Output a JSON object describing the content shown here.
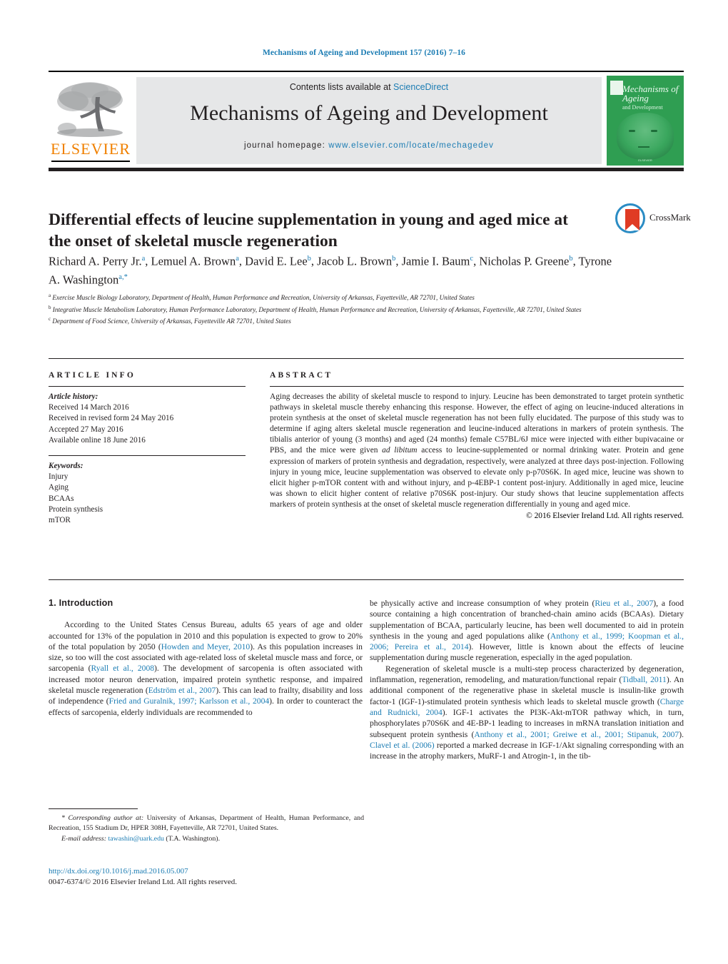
{
  "running_head": "Mechanisms of Ageing and Development 157 (2016) 7–16",
  "masthead": {
    "contents_prefix": "Contents lists available at ",
    "contents_link": "ScienceDirect",
    "journal_title": "Mechanisms of Ageing and Development",
    "homepage_label": "journal homepage: ",
    "homepage_url": "www.elsevier.com/locate/mechagedev",
    "publisher_wordmark": "ELSEVIER",
    "publisher_accent": "#f08000",
    "link_color": "#1b7cb3",
    "band_color": "#e6e7e8",
    "cover": {
      "title": "Mechanisms of Ageing",
      "subtitle": "and Development",
      "footer": "ELSEVIER",
      "background": "#2f9e52"
    }
  },
  "article": {
    "title": "Differential effects of leucine supplementation in young and aged mice at the onset of skeletal muscle regeneration",
    "crossmark_label": "CrossMark",
    "authors_html": "Richard A. Perry Jr.<sup>a</sup>, Lemuel A. Brown<sup>a</sup>, David E. Lee<sup>b</sup>, Jacob L. Brown<sup>b</sup>, Jamie I. Baum<sup>c</sup>, Nicholas P. Greene<sup>b</sup>, Tyrone A. Washington<sup>a,</sup><sup>*</sup>",
    "affiliations": [
      "Exercise Muscle Biology Laboratory, Department of Health, Human Performance and Recreation, University of Arkansas, Fayetteville, AR 72701, United States",
      "Integrative Muscle Metabolism Laboratory, Human Performance Laboratory, Department of Health, Human Performance and Recreation, University of Arkansas, Fayetteville, AR 72701, United States",
      "Department of Food Science, University of Arkansas, Fayetteville AR 72701, United States"
    ],
    "affiliation_marks": [
      "a",
      "b",
      "c"
    ]
  },
  "article_info": {
    "heading": "ARTICLE INFO",
    "history_label": "Article history:",
    "history": [
      "Received 14 March 2016",
      "Received in revised form 24 May 2016",
      "Accepted 27 May 2016",
      "Available online 18 June 2016"
    ],
    "keywords_label": "Keywords:",
    "keywords": [
      "Injury",
      "Aging",
      "BCAAs",
      "Protein synthesis",
      "mTOR"
    ]
  },
  "abstract": {
    "heading": "ABSTRACT",
    "text_html": "Aging decreases the ability of skeletal muscle to respond to injury. Leucine has been demonstrated to target protein synthetic pathways in skeletal muscle thereby enhancing this response. However, the effect of aging on leucine-induced alterations in protein synthesis at the onset of skeletal muscle regeneration has not been fully elucidated. The purpose of this study was to determine if aging alters skeletal muscle regeneration and leucine-induced alterations in markers of protein synthesis. The tibialis anterior of young (3 months) and aged (24 months) female C57BL/6J mice were injected with either bupivacaine or PBS, and the mice were given <i>ad libitum</i> access to leucine-supplemented or normal drinking water. Protein and gene expression of markers of protein synthesis and degradation, respectively, were analyzed at three days post-injection. Following injury in young mice, leucine supplementation was observed to elevate only p-p70S6K. In aged mice, leucine was shown to elicit higher p-mTOR content with and without injury, and p-4EBP-1 content post-injury. Additionally in aged mice, leucine was shown to elicit higher content of relative p70S6K post-injury. Our study shows that leucine supplementation affects markers of protein synthesis at the onset of skeletal muscle regeneration differentially in young and aged mice.",
    "copyright": "© 2016 Elsevier Ireland Ltd. All rights reserved."
  },
  "body": {
    "section_heading": "1. Introduction",
    "left_paragraphs_html": [
      "According to the United States Census Bureau, adults 65 years of age and older accounted for 13% of the population in 2010 and this population is expected to grow to 20% of the total population by 2050 (<span class=\"ref\">Howden and Meyer, 2010</span>). As this population increases in size, so too will the cost associated with age-related loss of skeletal muscle mass and force, or sarcopenia (<span class=\"ref\">Ryall et al., 2008</span>). The development of sarcopenia is often associated with increased motor neuron denervation, impaired protein synthetic response, and impaired skeletal muscle regeneration (<span class=\"ref\">Edström et al., 2007</span>). This can lead to frailty, disability and loss of independence (<span class=\"ref\">Fried and Guralnik, 1997; Karlsson et al., 2004</span>). In order to counteract the effects of sarcopenia, elderly individuals are recommended to"
    ],
    "right_paragraphs_html": [
      "be physically active and increase consumption of whey protein (<span class=\"ref\">Rieu et al., 2007</span>), a food source containing a high concentration of branched-chain amino acids (BCAAs). Dietary supplementation of BCAA, particularly leucine, has been well documented to aid in protein synthesis in the young and aged populations alike (<span class=\"ref\">Anthony et al., 1999; Koopman et al., 2006; Pereira et al., 2014</span>). However, little is known about the effects of leucine supplementation during muscle regeneration, especially in the aged population.",
      "Regeneration of skeletal muscle is a multi-step process characterized by degeneration, inflammation, regeneration, remodeling, and maturation/functional repair (<span class=\"ref\">Tidball, 2011</span>). An additional component of the regenerative phase in skeletal muscle is insulin-like growth factor-1 (IGF-1)-stimulated protein synthesis which leads to skeletal muscle growth (<span class=\"ref\">Charge and Rudnicki, 2004</span>). IGF-1 activates the PI3K-Akt-mTOR pathway which, in turn, phosphorylates p70S6K and 4E-BP-1 leading to increases in mRNA translation initiation and subsequent protein synthesis (<span class=\"ref\">Anthony et al., 2001; Greiwe et al., 2001; Stipanuk, 2007</span>). <span class=\"ref\">Clavel et al. (2006)</span> reported a marked decrease in IGF-1/Akt signaling corresponding with an increase in the atrophy markers, MuRF-1 and Atrogin-1, in the tib-"
    ]
  },
  "footnotes": {
    "corresponding_html": "* <i>Corresponding author at:</i> <span class=\"plain\">University of Arkansas, Department of Health, Human Performance, and Recreation, 155 Stadium Dr, HPER 308H, Fayetteville, AR 72701, United States.</span>",
    "email_label": "E-mail address:",
    "email": "tawashin@uark.edu",
    "email_suffix": "(T.A. Washington).",
    "doi": "http://dx.doi.org/10.1016/j.mad.2016.05.007",
    "issn_line": "0047-6374/© 2016 Elsevier Ireland Ltd. All rights reserved."
  }
}
